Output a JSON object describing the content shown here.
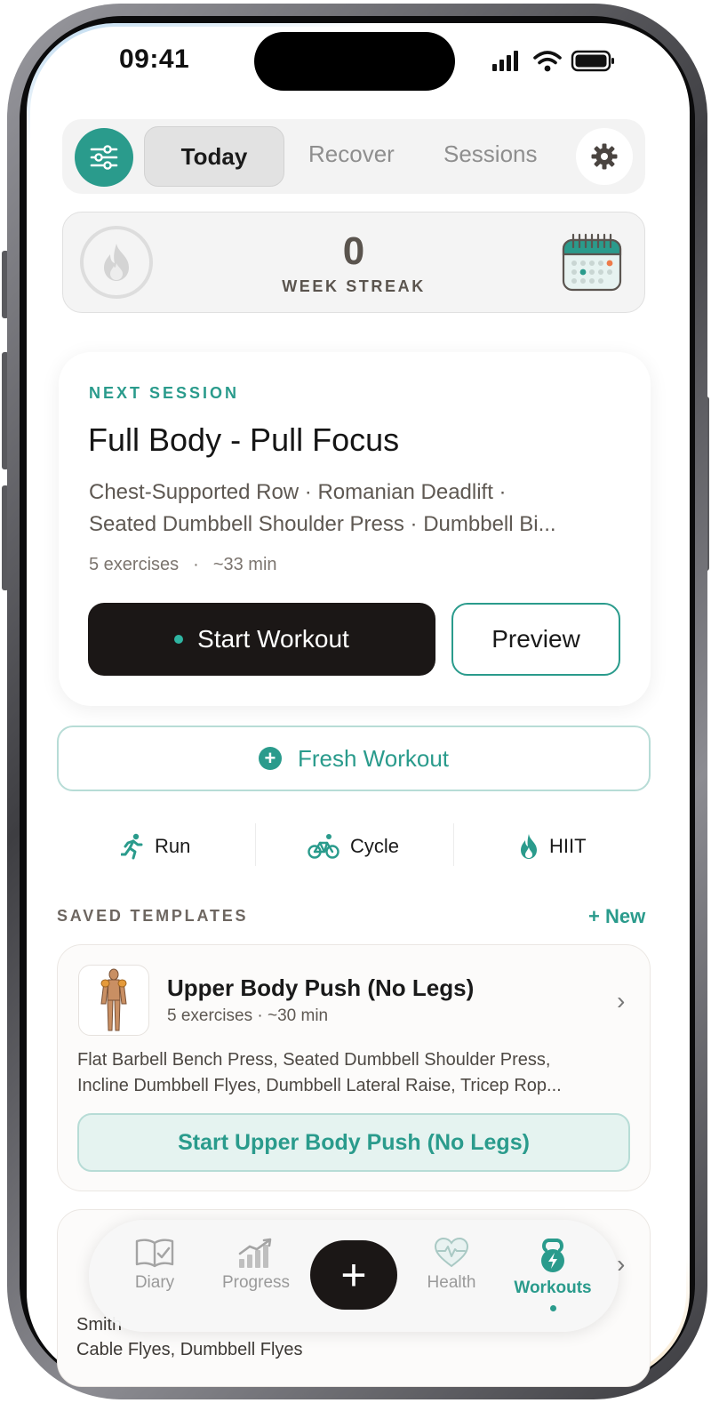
{
  "status_bar": {
    "time": "09:41"
  },
  "header": {
    "tabs": [
      {
        "label": "Today",
        "active": true
      },
      {
        "label": "Recover",
        "active": false
      },
      {
        "label": "Sessions",
        "active": false
      }
    ]
  },
  "streak": {
    "count": "0",
    "label": "WEEK STREAK"
  },
  "next_session": {
    "label": "NEXT SESSION",
    "title": "Full Body - Pull Focus",
    "exercises_line1": "Chest-Supported Row · Romanian Deadlift ·",
    "exercises_line2": "Seated Dumbbell Shoulder Press · Dumbbell Bi...",
    "exercise_count": "5 exercises",
    "separator": "·",
    "duration": "~33 min",
    "start_label": "Start Workout",
    "preview_label": "Preview"
  },
  "fresh_workout": {
    "label": "Fresh Workout"
  },
  "activities": [
    {
      "label": "Run",
      "icon": "running-icon"
    },
    {
      "label": "Cycle",
      "icon": "cycling-icon"
    },
    {
      "label": "HIIT",
      "icon": "flame-icon"
    }
  ],
  "saved_templates": {
    "label": "SAVED TEMPLATES",
    "new_label": "+ New",
    "items": [
      {
        "title": "Upper Body Push (No Legs)",
        "meta": "5 exercises · ~30 min",
        "exercises_line1": "Flat Barbell Bench Press, Seated Dumbbell Shoulder Press,",
        "exercises_line2": "Incline Dumbbell Flyes, Dumbbell Lateral Raise, Tricep Rop...",
        "start_label": "Start Upper Body Push (No Legs)"
      },
      {
        "exercises_line1": "Smith",
        "exercises_line2": "Cable Flyes, Dumbbell Flyes"
      }
    ]
  },
  "tab_bar": {
    "items": [
      {
        "label": "Diary",
        "active": false
      },
      {
        "label": "Progress",
        "active": false
      },
      {
        "label": "Health",
        "active": false
      },
      {
        "label": "Workouts",
        "active": true
      }
    ],
    "plus_label": "+"
  },
  "colors": {
    "accent": "#2a9b8c",
    "dark": "#1b1716",
    "muted_text": "#8e8e8e"
  }
}
